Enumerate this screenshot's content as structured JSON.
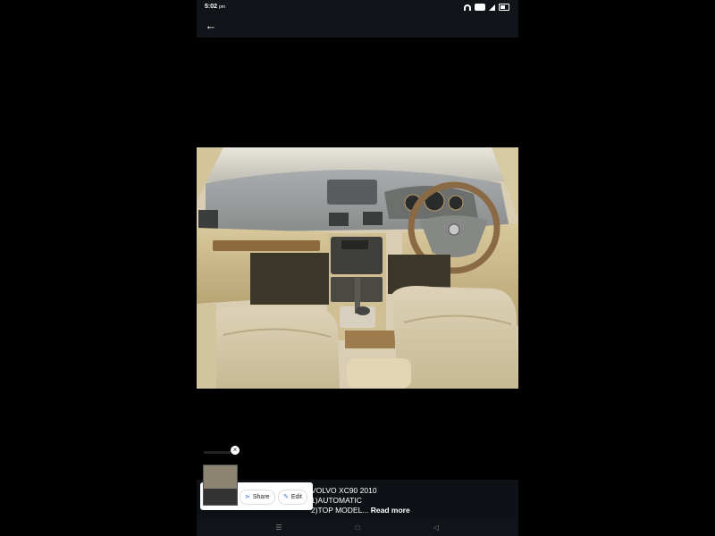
{
  "status_bar": {
    "time": "5:02",
    "time_suffix": "pm"
  },
  "app_bar": {
    "back_icon": "arrow-left-icon"
  },
  "post": {
    "line1": "VOLVO XC90 2010",
    "line2": "1)AUTOMATIC",
    "line3": "2)TOP MODEL...",
    "read_more": "Read more"
  },
  "popup": {
    "share_label": "Share",
    "edit_label": "Edit"
  }
}
